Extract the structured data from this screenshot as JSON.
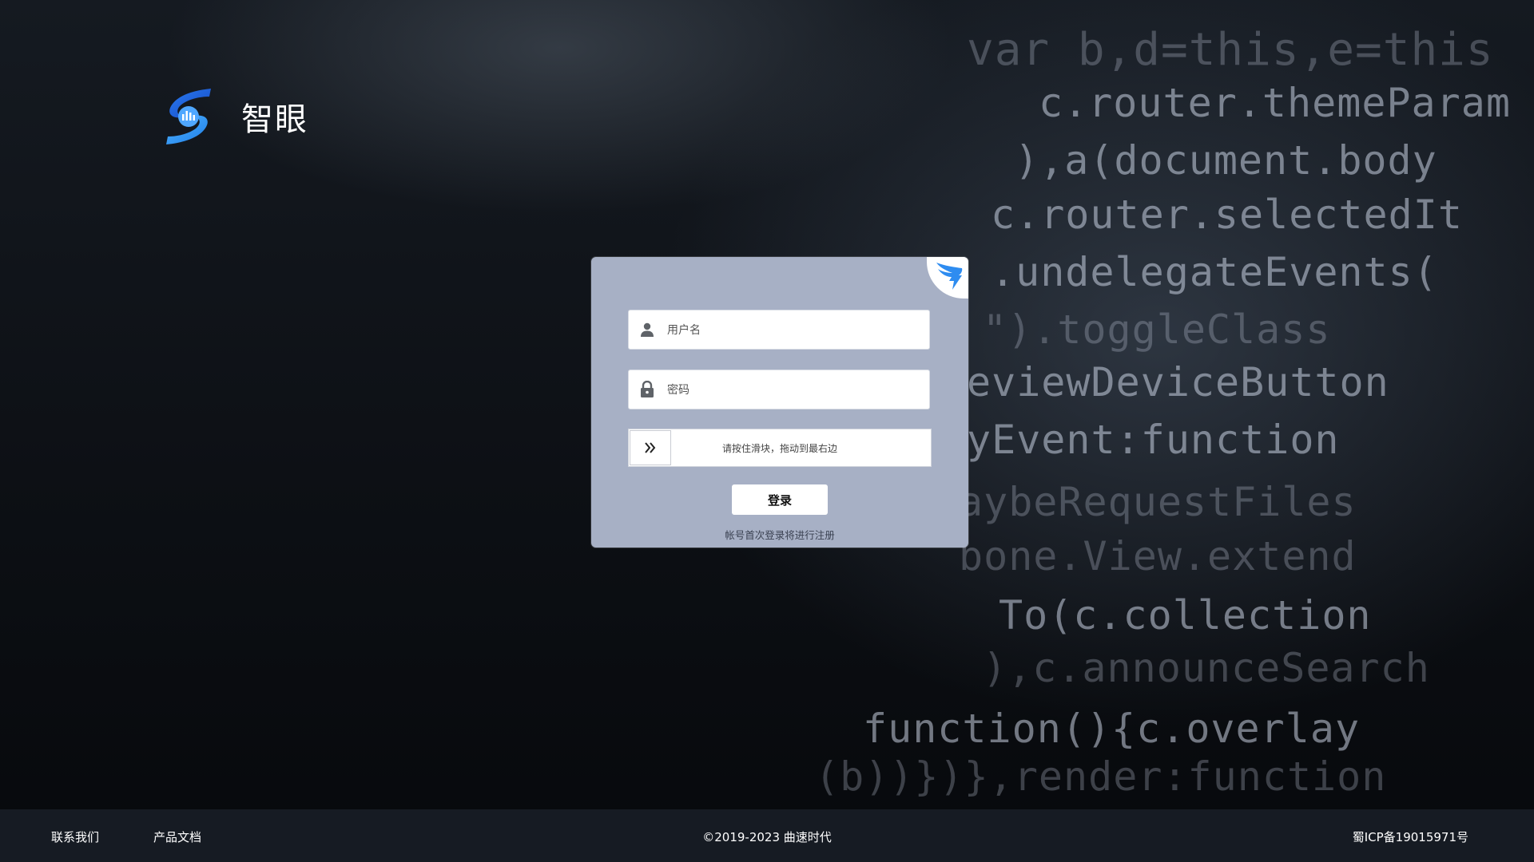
{
  "brand": {
    "name": "智眼",
    "logo_icon": "zhiyan-logo-icon"
  },
  "background_code": [
    "var b,d=this,e=this",
    "c.router.themeParam",
    "),a(document.body",
    "c.router.selectedIt",
    ".undelegateEvents(",
    "\").toggleClass",
    "eviewDeviceButton",
    "yEvent:function",
    "aybeRequestFiles",
    "bone.View.extend",
    "To(c.collection",
    "),c.announceSearch",
    "function(){c.overlay",
    "(b))})},render:function"
  ],
  "login": {
    "corner_icon": "dingtalk-icon",
    "username": {
      "placeholder": "用户名",
      "value": "",
      "icon": "user-icon"
    },
    "password": {
      "placeholder": "密码",
      "value": "",
      "icon": "lock-icon"
    },
    "slider": {
      "text": "请按住滑块，拖动到最右边",
      "handle_icon": "double-chevron-right-icon"
    },
    "submit_label": "登录",
    "register_note": "帐号首次登录将进行注册"
  },
  "footer": {
    "contact": "联系我们",
    "docs": "产品文档",
    "copyright": "©2019-2023 曲速时代",
    "icp": "蜀ICP备19015971号"
  },
  "colors": {
    "card_bg": "#a7b0c5",
    "footer_bg": "#161b23",
    "page_bg": "#0b0d11",
    "logo_blue": "#1f6fe0",
    "dingtalk_blue": "#2e8cf0"
  }
}
